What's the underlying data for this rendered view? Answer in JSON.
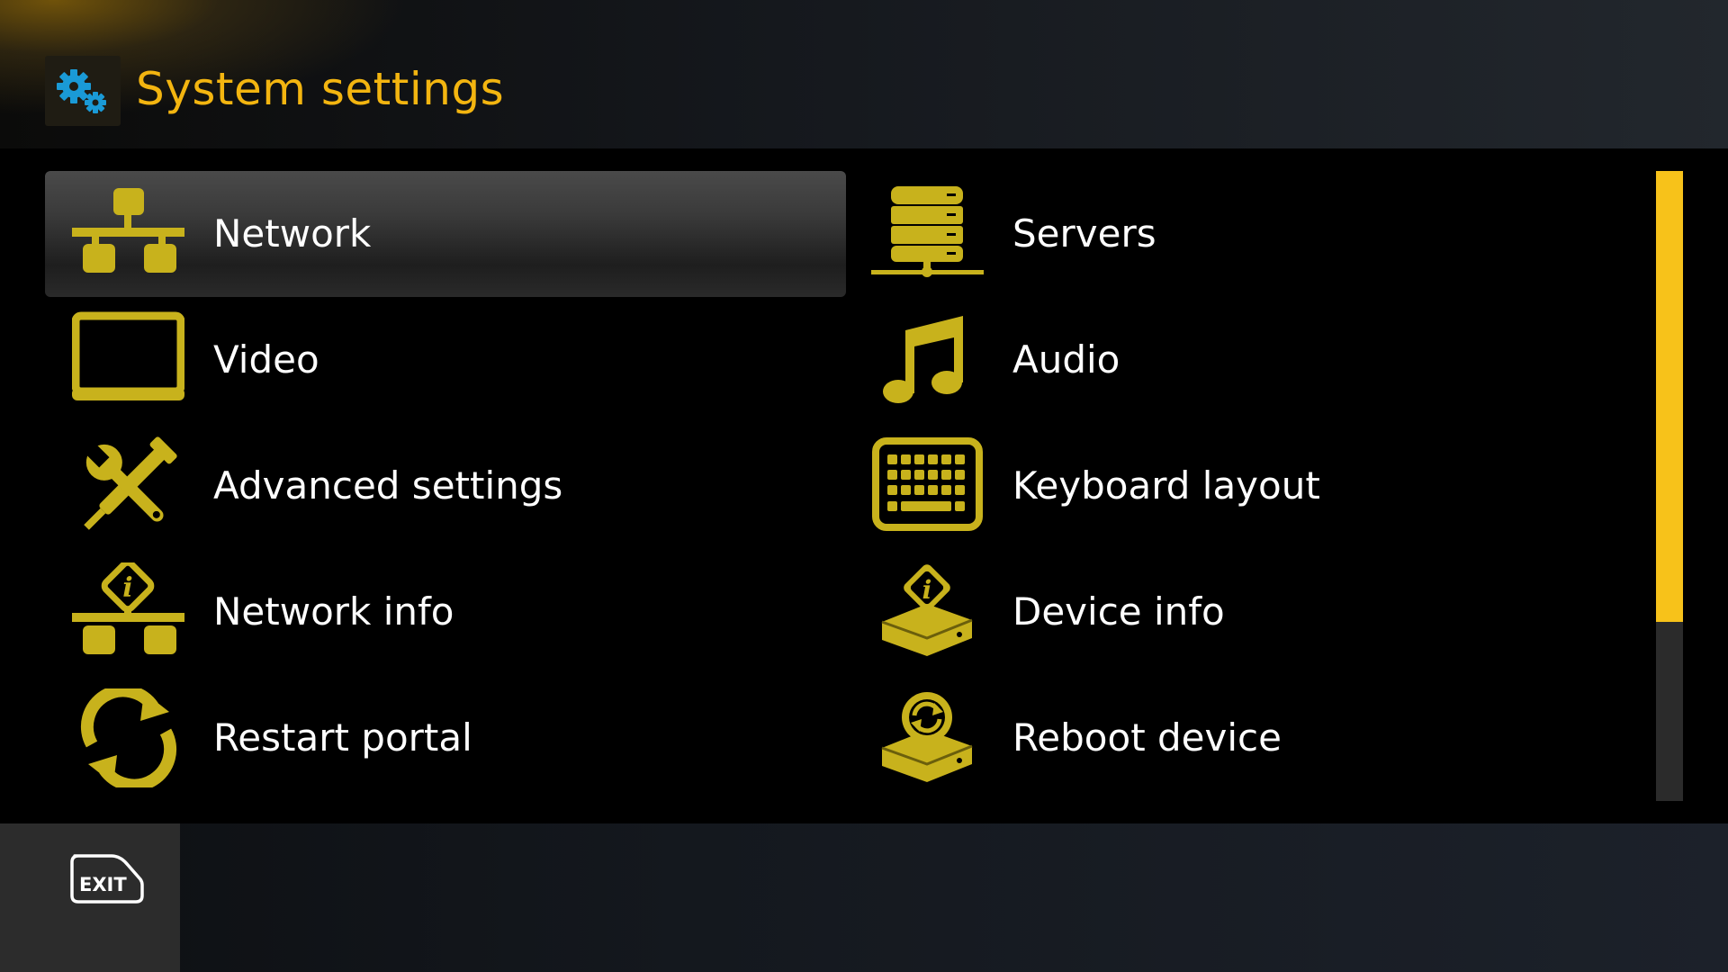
{
  "header": {
    "title": "System settings",
    "icon": "gears-icon"
  },
  "colors": {
    "accent": "#f3b510",
    "icon": "#c8b21c",
    "scrollbar_thumb": "#f7c21a",
    "selected_bg": "#3a3a3a"
  },
  "menu": {
    "selected_index": 0,
    "items": [
      {
        "label": "Network",
        "icon": "network-icon"
      },
      {
        "label": "Servers",
        "icon": "servers-icon"
      },
      {
        "label": "Video",
        "icon": "tv-icon"
      },
      {
        "label": "Audio",
        "icon": "music-note-icon"
      },
      {
        "label": "Advanced settings",
        "icon": "tools-icon"
      },
      {
        "label": "Keyboard layout",
        "icon": "keyboard-icon"
      },
      {
        "label": "Network info",
        "icon": "network-info-icon"
      },
      {
        "label": "Device info",
        "icon": "device-info-icon"
      },
      {
        "label": "Restart portal",
        "icon": "restart-icon"
      },
      {
        "label": "Reboot device",
        "icon": "reboot-device-icon"
      }
    ]
  },
  "scrollbar": {
    "visible_fraction": 0.715
  },
  "footer": {
    "exit_label": "EXIT",
    "exit_icon": "exit-key-icon"
  }
}
